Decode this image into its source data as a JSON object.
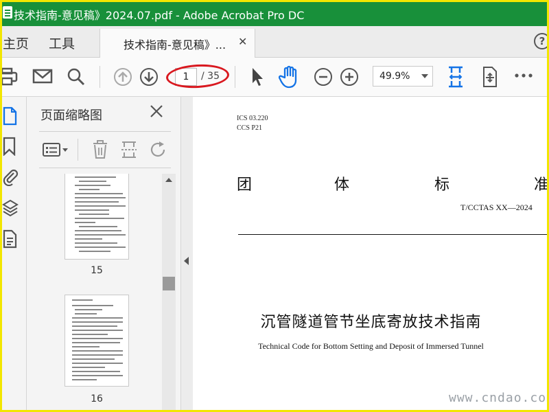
{
  "window": {
    "title": "技术指南-意见稿》2024.07.pdf - Adobe Acrobat Pro DC"
  },
  "nav": {
    "home": "主页",
    "tools": "工具"
  },
  "tab": {
    "label": "技术指南-意见稿》...",
    "close": "✕"
  },
  "help": {
    "label": "?"
  },
  "toolbar": {
    "page_current": "1",
    "page_total": "/ 35",
    "zoom": "49.9%"
  },
  "thumbnails": {
    "title": "页面缩略图",
    "pages": [
      {
        "number": "15"
      },
      {
        "number": "16"
      }
    ]
  },
  "document": {
    "ics": "ICS   03.220",
    "ccs": "CCS  P21",
    "standard_chars": [
      "团",
      "体",
      "标",
      "准"
    ],
    "code": "T/CCTAS  XX—2024",
    "title": "沉管隧道管节坐底寄放技术指南",
    "subtitle": "Technical Code for Bottom Setting and Deposit of Immersed Tunnel"
  },
  "watermark": "www.cndao.com",
  "colors": {
    "titlebar": "#18903a",
    "accent_blue": "#1473e6",
    "annotation_red": "#d9181f",
    "frame_yellow": "#f2e600"
  }
}
